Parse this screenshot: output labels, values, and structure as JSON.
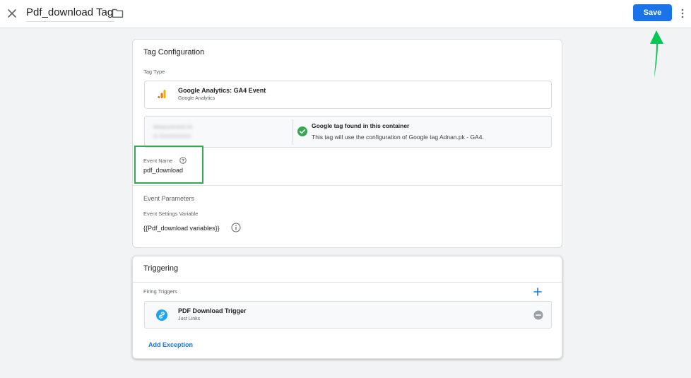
{
  "header": {
    "tag_title": "Pdf_download Tag",
    "save_label": "Save",
    "close_icon": "close-icon",
    "folder_icon": "folder-icon",
    "more_icon": "more-vert-icon"
  },
  "annotation": {
    "arrow_color": "#00c853",
    "highlight_color": "#34a853"
  },
  "tag_configuration": {
    "title": "Tag Configuration",
    "tag_type_label": "Tag Type",
    "tag_type": {
      "name": "Google Analytics: GA4 Event",
      "subtitle": "Google Analytics",
      "icon": "analytics-icon"
    },
    "google_tag": {
      "blurred_label": "Measurement ID",
      "blurred_value": "G-XXXXXXXXX",
      "status_title": "Google tag found in this container",
      "status_desc": "This tag will use the configuration of Google tag Adnan.pk - GA4.",
      "status_icon": "check-circle-icon"
    },
    "event_name_label": "Event Name",
    "event_name_value": "pdf_download",
    "event_parameters_title": "Event Parameters",
    "event_settings_label": "Event Settings Variable",
    "event_settings_value": "{{Pdf_download variables}}"
  },
  "triggering": {
    "title": "Triggering",
    "firing_triggers_label": "Firing Triggers",
    "triggers": [
      {
        "name": "PDF Download Trigger",
        "type": "Just Links",
        "icon": "link-icon"
      }
    ],
    "add_exception_label": "Add Exception"
  },
  "colors": {
    "accent": "#1a73e8",
    "success": "#34a853",
    "background": "#f1f3f4"
  }
}
